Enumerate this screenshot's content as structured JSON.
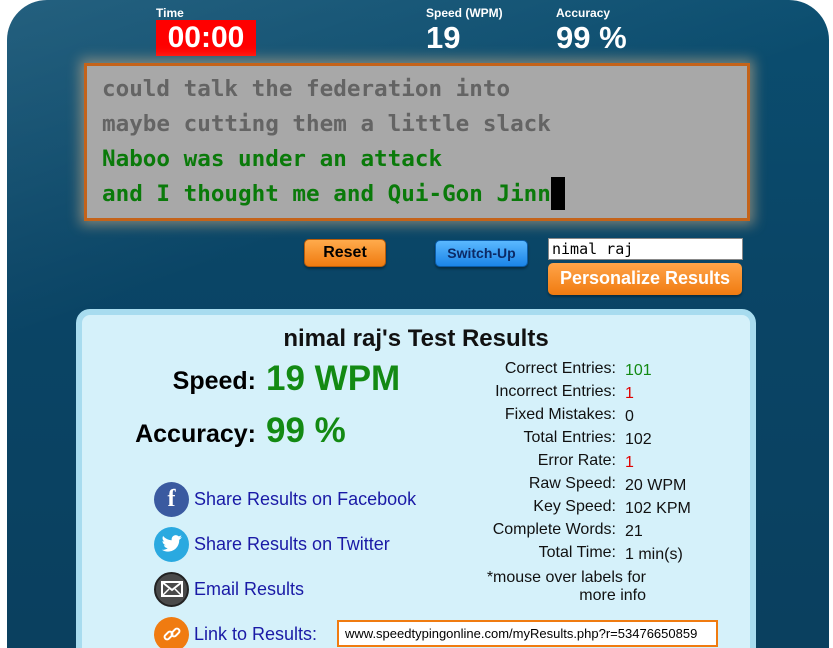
{
  "header": {
    "time_label": "Time",
    "time_value": "00:00",
    "speed_label": "Speed (WPM)",
    "speed_value": "19",
    "accuracy_label": "Accuracy",
    "accuracy_value": "99 %"
  },
  "typing": {
    "lines": [
      {
        "text": "could talk the federation into",
        "state": "pending"
      },
      {
        "text": "maybe cutting them a little slack",
        "state": "pending"
      },
      {
        "text": "Naboo was under an attack",
        "state": "done"
      },
      {
        "text": "and I thought me and Qui-Gon Jinn",
        "state": "done"
      }
    ]
  },
  "controls": {
    "reset_label": "Reset",
    "switch_label": "Switch-Up",
    "name_value": "nimal raj",
    "personalize_label": "Personalize Results"
  },
  "results": {
    "title": "nimal raj's Test Results",
    "speed_label": "Speed:",
    "speed_value": "19 WPM",
    "accuracy_label": "Accuracy:",
    "accuracy_value": "99 %",
    "share": {
      "facebook": "Share Results on Facebook",
      "twitter": "Share Results on Twitter",
      "email": "Email Results",
      "link": "Link to Results:"
    },
    "link_url": "www.speedtypingonline.com/myResults.php?r=53476650859",
    "details": [
      {
        "label": "Correct Entries:",
        "value": "101",
        "color": "green"
      },
      {
        "label": "Incorrect Entries:",
        "value": "1",
        "color": "red"
      },
      {
        "label": "Fixed Mistakes:",
        "value": "0",
        "color": "normal"
      },
      {
        "label": "Total Entries:",
        "value": "102",
        "color": "normal"
      },
      {
        "label": "Error Rate:",
        "value": "1",
        "color": "red"
      },
      {
        "label": "Raw Speed:",
        "value": "20 WPM",
        "color": "normal"
      },
      {
        "label": "Key Speed:",
        "value": "102 KPM",
        "color": "normal"
      },
      {
        "label": "Complete Words:",
        "value": "21",
        "color": "normal"
      },
      {
        "label": "Total Time:",
        "value": "1 min(s)",
        "color": "normal"
      }
    ],
    "note_line1": "*mouse over labels for",
    "note_line2": "more info"
  },
  "colors": {
    "accent_orange": "#f07b10",
    "timer_red": "#ff0000",
    "good_green": "#138a13",
    "bad_red": "#e00000"
  },
  "icons": [
    "facebook-icon",
    "twitter-icon",
    "email-icon",
    "link-icon"
  ]
}
